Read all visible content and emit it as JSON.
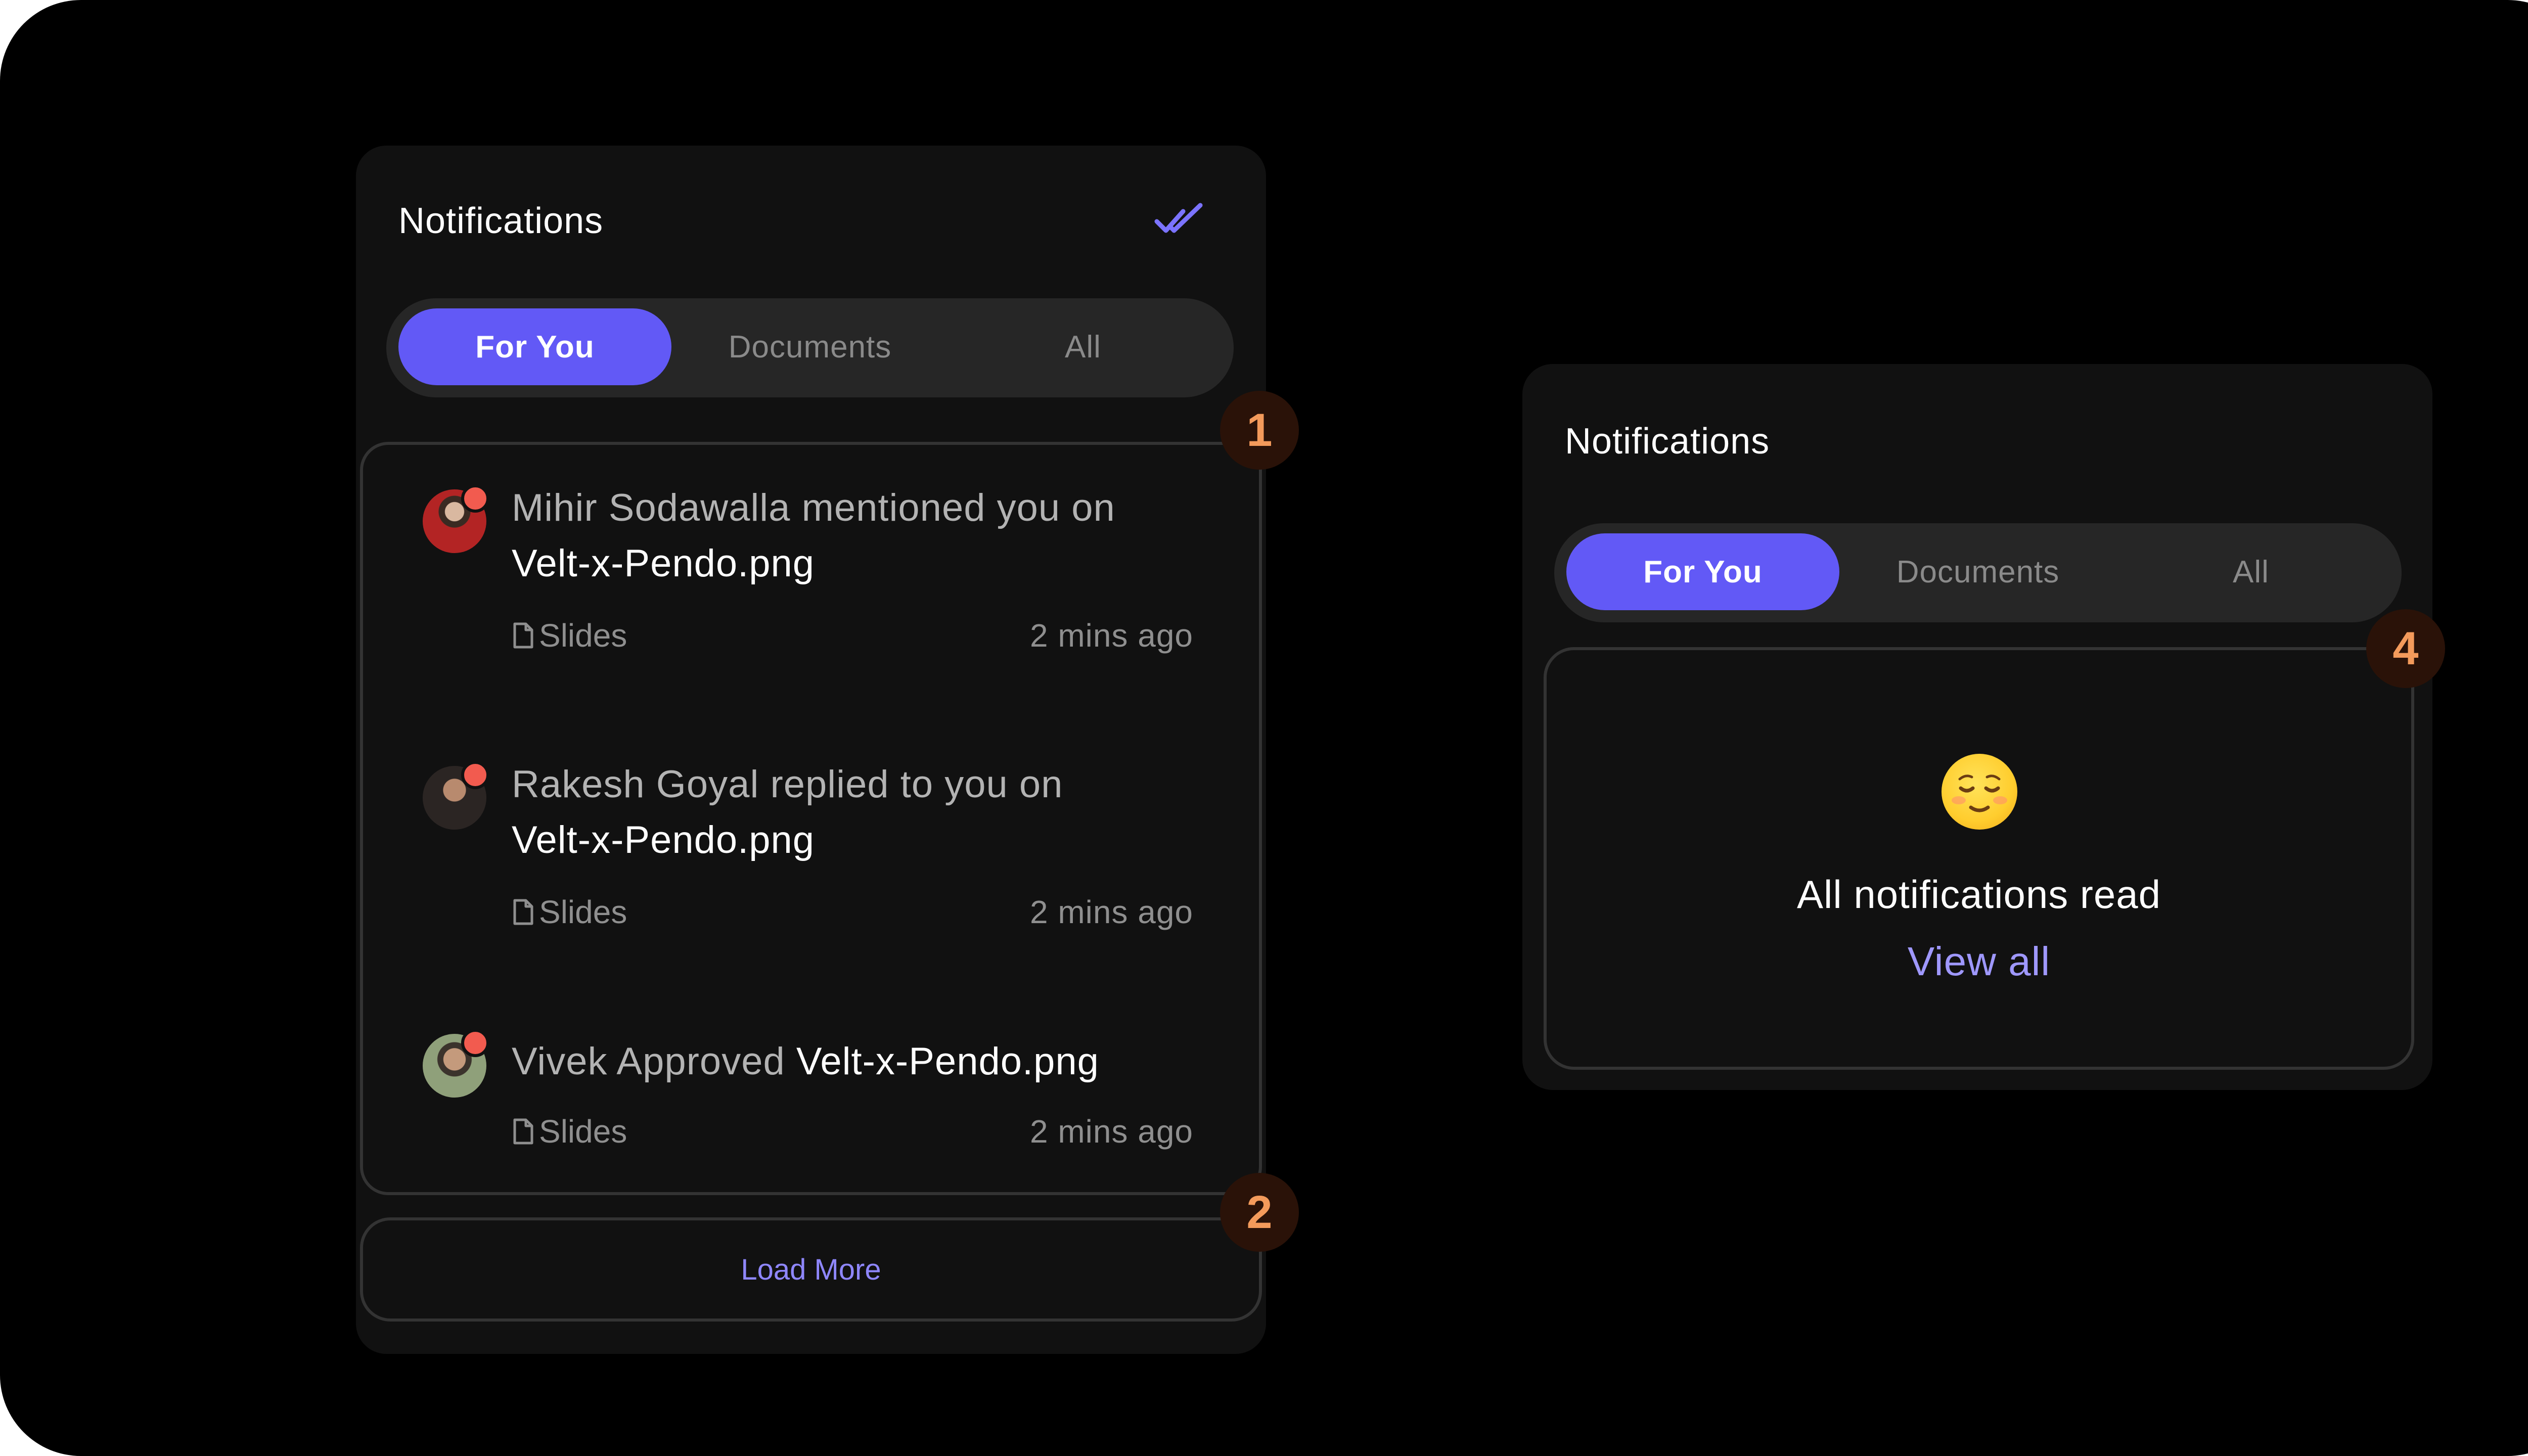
{
  "left_panel": {
    "title": "Notifications",
    "mark_all_read_icon": "double-check-icon",
    "tabs": [
      {
        "label": "For You",
        "active": true
      },
      {
        "label": "Documents",
        "active": false
      },
      {
        "label": "All",
        "active": false
      }
    ],
    "notifications": [
      {
        "actor_text": "Mihir Sodawalla mentioned you on",
        "file": "Velt-x-Pendo.png",
        "document": "Slides",
        "time": "2 mins ago",
        "unread": true
      },
      {
        "actor_text": "Rakesh Goyal replied to you on",
        "file": "Velt-x-Pendo.png",
        "document": "Slides",
        "time": "2 mins ago",
        "unread": true
      },
      {
        "actor_text": "Vivek Approved",
        "file": "Velt-x-Pendo.png",
        "document": "Slides",
        "time": "2 mins ago",
        "unread": true
      }
    ],
    "load_more_label": "Load More",
    "badges": [
      "1",
      "2"
    ]
  },
  "right_panel": {
    "title": "Notifications",
    "tabs": [
      {
        "label": "For You",
        "active": true
      },
      {
        "label": "Documents",
        "active": false
      },
      {
        "label": "All",
        "active": false
      }
    ],
    "empty_state": {
      "emoji_icon": "relieved-face-icon",
      "message": "All notifications read",
      "link_label": "View all"
    },
    "badge": "4"
  },
  "colors": {
    "background": "#000000",
    "panel": "#111111",
    "accent": "#6259f6",
    "link": "#9f98ff",
    "unread_dot": "#f25b4f",
    "badge_text": "#f39a5b"
  }
}
